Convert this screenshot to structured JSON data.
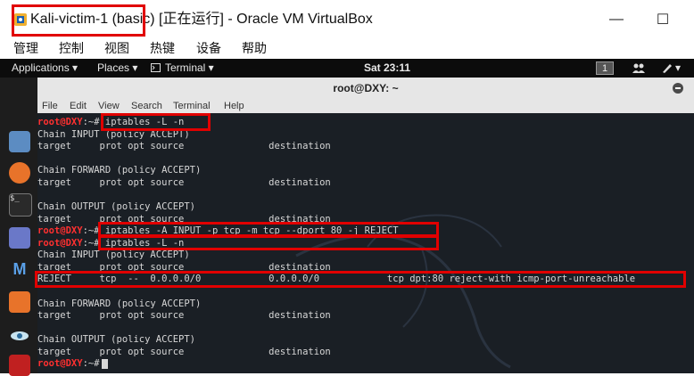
{
  "window": {
    "title": "Kali-victim-1 (basic) [正在运行] - Oracle VM VirtualBox",
    "minimize": "—",
    "maximize": "☐",
    "app_icon": "virtualbox-icon"
  },
  "menubar": {
    "items": [
      "管理",
      "控制",
      "视图",
      "热键",
      "设备",
      "帮助"
    ]
  },
  "panel": {
    "applications": "Applications ▾",
    "places": "Places ▾",
    "terminal": "Terminal ▾",
    "clock": "Sat 23:11",
    "workspace": "1"
  },
  "dock": {
    "icons": [
      "files-icon",
      "firefox-icon",
      "terminal-icon",
      "text-editor-icon",
      "metasploit-icon",
      "burpsuite-icon",
      "eye-icon",
      "app-icon"
    ]
  },
  "terminal": {
    "title": "root@DXY: ~",
    "menu": [
      "File",
      "Edit",
      "View",
      "Search",
      "Terminal",
      "Help"
    ],
    "prompt": "root@DXY",
    "path": ":~#",
    "lines": [
      {
        "type": "cmd",
        "text": " iptables -L -n"
      },
      {
        "type": "out",
        "text": "Chain INPUT (policy ACCEPT)"
      },
      {
        "type": "out",
        "text": "target     prot opt source               destination"
      },
      {
        "type": "out",
        "text": ""
      },
      {
        "type": "out",
        "text": "Chain FORWARD (policy ACCEPT)"
      },
      {
        "type": "out",
        "text": "target     prot opt source               destination"
      },
      {
        "type": "out",
        "text": ""
      },
      {
        "type": "out",
        "text": "Chain OUTPUT (policy ACCEPT)"
      },
      {
        "type": "out",
        "text": "target     prot opt source               destination"
      },
      {
        "type": "cmd",
        "text": " iptables -A INPUT -p tcp -m tcp --dport 80 -j REJECT"
      },
      {
        "type": "cmd",
        "text": " iptables -L -n"
      },
      {
        "type": "out",
        "text": "Chain INPUT (policy ACCEPT)"
      },
      {
        "type": "out",
        "text": "target     prot opt source               destination"
      },
      {
        "type": "out",
        "text": "REJECT     tcp  --  0.0.0.0/0            0.0.0.0/0            tcp dpt:80 reject-with icmp-port-unreachable"
      },
      {
        "type": "out",
        "text": ""
      },
      {
        "type": "out",
        "text": "Chain FORWARD (policy ACCEPT)"
      },
      {
        "type": "out",
        "text": "target     prot opt source               destination"
      },
      {
        "type": "out",
        "text": ""
      },
      {
        "type": "out",
        "text": "Chain OUTPUT (policy ACCEPT)"
      },
      {
        "type": "out",
        "text": "target     prot opt source               destination"
      },
      {
        "type": "cmd",
        "text": ""
      }
    ]
  },
  "colors": {
    "annotation": "#e10000",
    "prompt": "#ff3030"
  }
}
